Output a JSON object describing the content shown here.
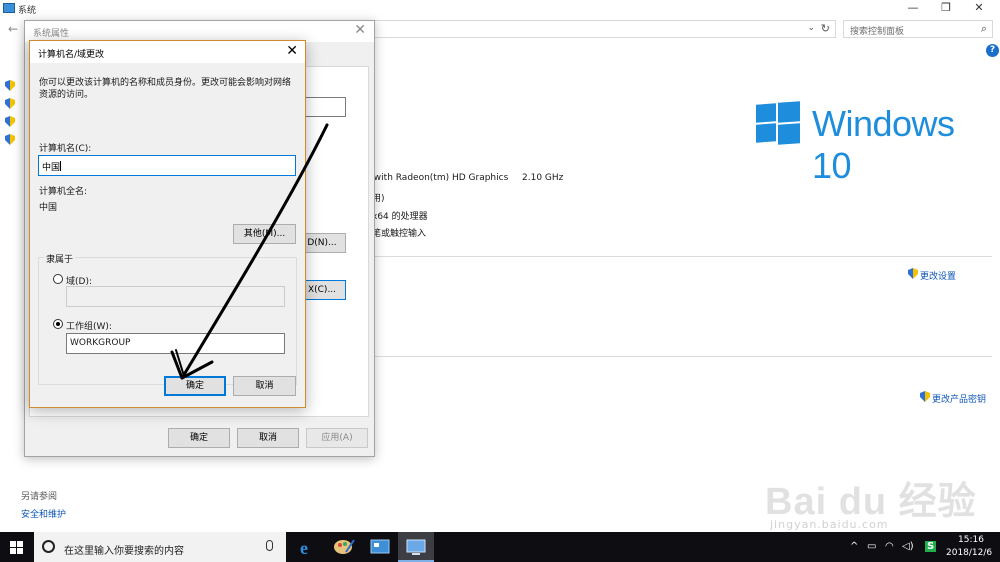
{
  "system_window": {
    "title": "系统",
    "minimize": "—",
    "maximize": "❐",
    "close": "✕",
    "back_glyph": "←",
    "search_placeholder": "搜索控制面板",
    "help": "?",
    "windows_brand": "Windows 10",
    "processor": " with Radeon(tm) HD Graphics",
    "processor_speed": "2.10 GHz",
    "info_line2": "用)",
    "info_line3": "x64 的处理器",
    "info_line4": "笔或触控输入",
    "change_settings": "更改设置",
    "change_product_key": "更改产品密钥",
    "see_also": "另请参阅",
    "security_link": "安全和维护",
    "left_items": [
      "",
      "",
      "",
      ""
    ]
  },
  "system_properties": {
    "title": "系统属性",
    "close": "✕",
    "btn_network_id": "D(N)...",
    "btn_change": "X(C)...",
    "ok": "确定",
    "cancel": "取消",
    "apply": "应用(A)"
  },
  "computer_name_dialog": {
    "title": "计算机名/域更改",
    "close": "✕",
    "description": "你可以更改该计算机的名称和成员身份。更改可能会影响对网络资源的访问。",
    "computer_name_label": "计算机名(C):",
    "computer_name_value": "中国",
    "full_name_label": "计算机全名:",
    "full_name_value": "中国",
    "more_button": "其他(M)...",
    "member_of": "隶属于",
    "domain_label": "域(D):",
    "domain_value": "",
    "workgroup_label": "工作组(W):",
    "workgroup_value": "WORKGROUP",
    "ok": "确定",
    "cancel": "取消"
  },
  "taskbar": {
    "search_placeholder": "在这里输入你要搜索的内容",
    "time": "15:16",
    "date": "2018/12/6",
    "tray_glyphs": [
      "^",
      "▭",
      "◠",
      "◁)",
      "S"
    ]
  },
  "watermark": {
    "logo": "Bai du 经验",
    "url": "jingyan.baidu.com"
  },
  "colors": {
    "accent": "#0078d7",
    "windows_blue": "#1e8ddb",
    "link_blue": "#0d55b5",
    "dialog_border": "#d08c2c",
    "taskbar": "#0e0e12"
  }
}
